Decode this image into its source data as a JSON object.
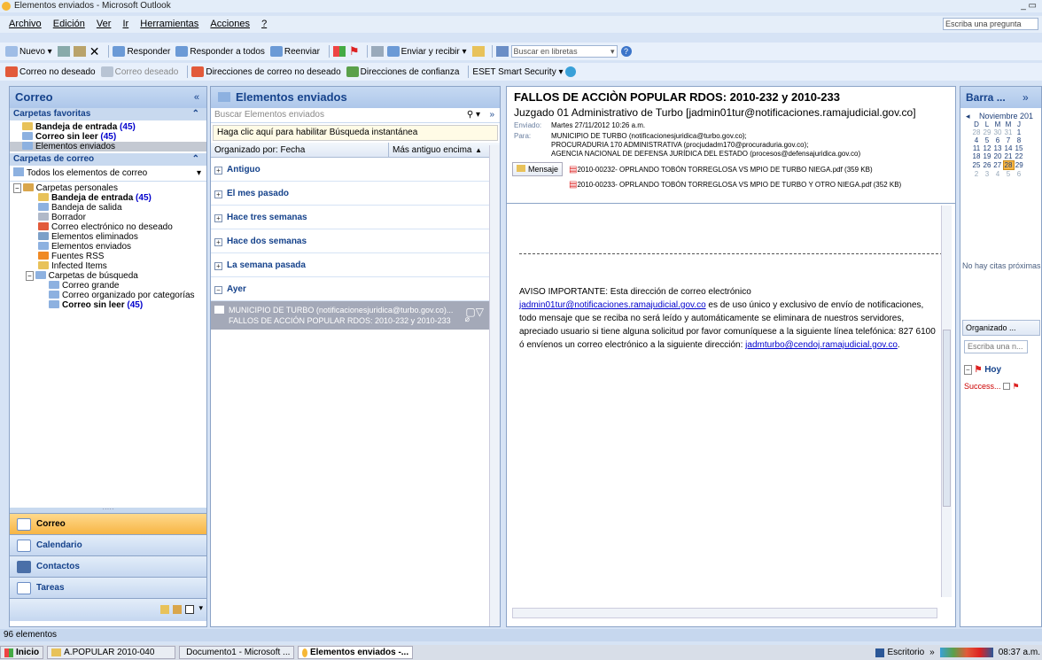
{
  "window": {
    "title": "Elementos enviados - Microsoft Outlook",
    "controls": "_ ▭"
  },
  "menu": {
    "items": [
      "Archivo",
      "Edición",
      "Ver",
      "Ir",
      "Herramientas",
      "Acciones",
      "?"
    ],
    "help_placeholder": "Escriba una pregunta"
  },
  "toolbar1": {
    "nuevo": "Nuevo",
    "responder": "Responder",
    "responder_todos": "Responder a todos",
    "reenviar": "Reenviar",
    "enviar_recibir": "Enviar y recibir",
    "buscar_libretas": "Buscar en libretas"
  },
  "toolbar2": {
    "correo_no_deseado": "Correo no deseado",
    "correo_deseado": "Correo deseado",
    "direcciones_no_deseado": "Direcciones de correo no deseado",
    "direcciones_confianza": "Direcciones de confianza",
    "eset": "ESET Smart Security"
  },
  "nav": {
    "title": "Correo",
    "favoritas_label": "Carpetas favoritas",
    "favoritas": [
      {
        "label": "Bandeja de entrada",
        "count": "(45)"
      },
      {
        "label": "Correo sin leer",
        "count": "(45)"
      },
      {
        "label": "Elementos enviados",
        "count": ""
      }
    ],
    "carpetas_label": "Carpetas de correo",
    "todos": "Todos los elementos de correo",
    "personales": "Carpetas personales",
    "folders": [
      {
        "label": "Bandeja de entrada",
        "count": "(45)"
      },
      {
        "label": "Bandeja de salida",
        "count": ""
      },
      {
        "label": "Borrador",
        "count": ""
      },
      {
        "label": "Correo electrónico no deseado",
        "count": ""
      },
      {
        "label": "Elementos eliminados",
        "count": ""
      },
      {
        "label": "Elementos enviados",
        "count": ""
      },
      {
        "label": "Fuentes RSS",
        "count": ""
      },
      {
        "label": "Infected Items",
        "count": ""
      }
    ],
    "busqueda": "Carpetas de búsqueda",
    "busqueda_items": [
      {
        "label": "Correo grande",
        "count": ""
      },
      {
        "label": "Correo organizado por categorías",
        "count": ""
      },
      {
        "label": "Correo sin leer",
        "count": "(45)"
      }
    ],
    "buttons": [
      "Correo",
      "Calendario",
      "Contactos",
      "Tareas"
    ]
  },
  "list": {
    "title": "Elementos enviados",
    "search_placeholder": "Buscar Elementos enviados",
    "instant_search": "Haga clic aquí para habilitar Búsqueda instantánea",
    "sort_by": "Organizado por: Fecha",
    "sort_order": "Más antiguo encima",
    "groups": [
      "Antiguo",
      "El mes pasado",
      "Hace tres semanas",
      "Hace dos semanas",
      "La semana pasada",
      "Ayer"
    ],
    "item": {
      "from": "MUNICIPIO DE TURBO (notificacionesjuridica@turbo.gov.co)...",
      "subject": "FALLOS DE ACCIÓN POPULAR RDOS: 2010-232 y 2010-233"
    }
  },
  "reading": {
    "subject": "FALLOS DE ACCIÒN POPULAR RDOS: 2010-232 y 2010-233",
    "from": "Juzgado 01 Administrativo de Turbo [jadmin01tur@notificaciones.ramajudicial.gov.co]",
    "sent_label": "Enviado:",
    "sent": "Martes 27/11/2012 10:26 a.m.",
    "to_label": "Para:",
    "to": [
      "MUNICIPIO DE TURBO (notificacionesjuridica@turbo.gov.co);",
      "PROCURADURIA 170 ADMINISTRATIVA (procjudadm170@procuraduria.gov.co);",
      "AGENCIA NACIONAL DE DEFENSA JURÍDICA DEL ESTADO (procesos@defensajuridica.gov.co)"
    ],
    "mensaje": "Mensaje",
    "attachments": [
      "2010-00232- OPRLANDO TOBÓN TORREGLOSA VS MPIO DE TURBO NIEGA.pdf (359 KB)",
      "2010-00233- OPRLANDO TOBÓN TORREGLOSA VS MPIO DE TURBO Y OTRO  NIEGA.pdf (352 KB)"
    ],
    "body_intro": "AVISO IMPORTANTE: Esta dirección de correo electrónico",
    "body_link1": "jadmin01tur@notificaciones.ramajudicial.gov.co",
    "body_mid": " es de uso único y exclusivo de envío de notificaciones, todo mensaje que se reciba no será leído y automáticamente se eliminara de nuestros servidores, apreciado usuario si tiene alguna solicitud por favor comuníquese a la siguiente línea telefónica: 827 6100 ó envíenos un correo electrónico a la siguiente dirección: ",
    "body_link2": "jadmturbo@cendoj.ramajudicial.gov.co",
    "body_end": "."
  },
  "todo": {
    "title": "Barra ...",
    "month": "Noviembre 201",
    "days": [
      "D",
      "L",
      "M",
      "M",
      "J"
    ],
    "weeks": [
      [
        "28",
        "29",
        "30",
        "31",
        "1"
      ],
      [
        "4",
        "5",
        "6",
        "7",
        "8"
      ],
      [
        "11",
        "12",
        "13",
        "14",
        "15"
      ],
      [
        "18",
        "19",
        "20",
        "21",
        "22"
      ],
      [
        "25",
        "26",
        "27",
        "28",
        "29"
      ],
      [
        "2",
        "3",
        "4",
        "5",
        "6"
      ]
    ],
    "no_citas": "No hay citas próximas",
    "organizado": "Organizado ...",
    "escriba": "Escriba una n...",
    "hoy": "Hoy",
    "task": "Success..."
  },
  "status": {
    "count": "96 elementos"
  },
  "taskbar": {
    "inicio": "Inicio",
    "items": [
      "A.POPULAR 2010-040",
      "Documento1 - Microsoft ...",
      "Elementos enviados -..."
    ],
    "escritorio": "Escritorio",
    "time": "08:37 a.m."
  }
}
